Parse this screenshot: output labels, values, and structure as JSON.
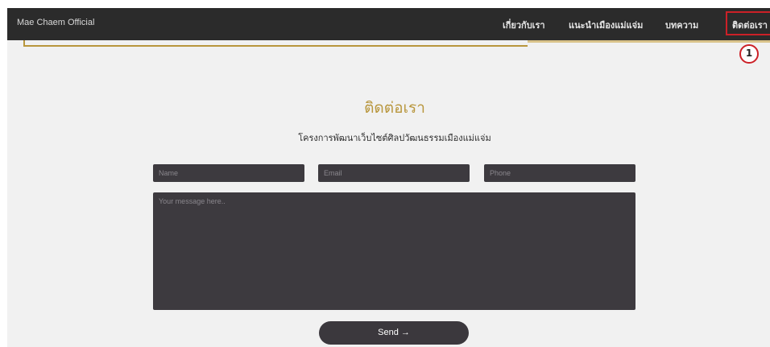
{
  "header": {
    "brand": "Mae Chaem Official",
    "nav": {
      "about": "เกี่ยวกับเรา",
      "guide": "แนะนำเมืองแม่แจ่ม",
      "articles": "บทความ",
      "contact": "ติดต่อเรา"
    },
    "step_marker": "1"
  },
  "contact": {
    "title": "ติดต่อเรา",
    "subtitle": "โครงการพัฒนาเว็บไซต์ศิลปวัฒนธรรมเมืองแม่แจ่ม",
    "name_placeholder": "Name",
    "email_placeholder": "Email",
    "phone_placeholder": "Phone",
    "message_placeholder": "Your message here..",
    "send_label": "Send →"
  },
  "colors": {
    "navbar": "#2b2b2b",
    "accent_gold": "#b8963c",
    "highlight_red": "#cc2027",
    "field_background": "#3d3a3f",
    "page_background": "#f1f1f1"
  }
}
